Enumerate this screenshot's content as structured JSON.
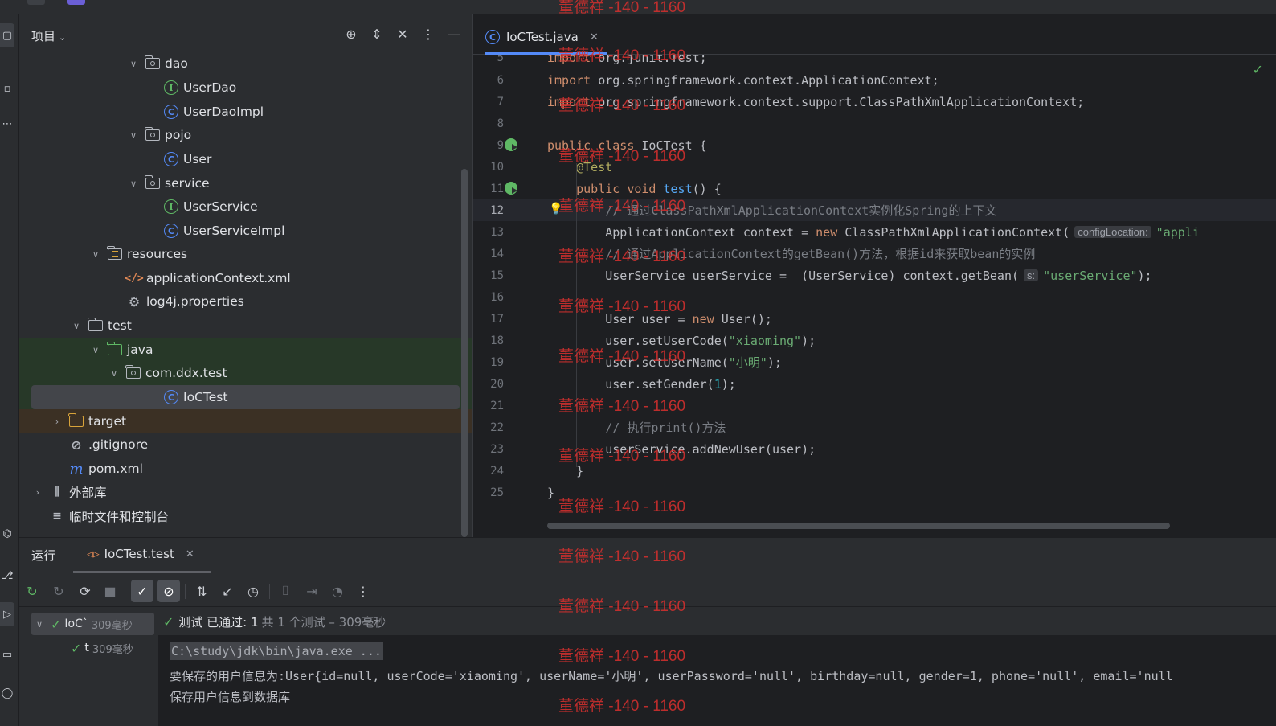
{
  "project": {
    "title": "项目",
    "tree": [
      {
        "label": "dao",
        "kind": "package",
        "expanded": true
      },
      {
        "label": "UserDao",
        "kind": "interface"
      },
      {
        "label": "UserDaoImpl",
        "kind": "class"
      },
      {
        "label": "pojo",
        "kind": "package",
        "expanded": true
      },
      {
        "label": "User",
        "kind": "class"
      },
      {
        "label": "service",
        "kind": "package",
        "expanded": true
      },
      {
        "label": "UserService",
        "kind": "interface"
      },
      {
        "label": "UserServiceImpl",
        "kind": "class"
      },
      {
        "label": "resources",
        "kind": "resources-folder",
        "expanded": true
      },
      {
        "label": "applicationContext.xml",
        "kind": "xml"
      },
      {
        "label": "log4j.properties",
        "kind": "properties"
      },
      {
        "label": "test",
        "kind": "folder",
        "expanded": true
      },
      {
        "label": "java",
        "kind": "test-source-folder",
        "expanded": true
      },
      {
        "label": "com.ddx.test",
        "kind": "package",
        "expanded": true
      },
      {
        "label": "IoCTest",
        "kind": "class",
        "selected": true
      },
      {
        "label": "target",
        "kind": "excluded-folder",
        "expanded": false
      },
      {
        "label": ".gitignore",
        "kind": "ignore-file"
      },
      {
        "label": "pom.xml",
        "kind": "maven"
      },
      {
        "label": "外部库",
        "kind": "library",
        "expanded": false
      },
      {
        "label": "临时文件和控制台",
        "kind": "scratch"
      }
    ]
  },
  "editor": {
    "tab_label": "IoCTest.java",
    "current_line": 12,
    "lines": [
      {
        "n": "5",
        "text": "import org.junit.Test;"
      },
      {
        "n": "6",
        "text": "import org.springframework.context.ApplicationContext;"
      },
      {
        "n": "7",
        "text": "import org.springframework.context.support.ClassPathXmlApplicationContext;"
      },
      {
        "n": "8",
        "text": ""
      },
      {
        "n": "9",
        "text": "public class IoCTest {"
      },
      {
        "n": "10",
        "text": "    @Test"
      },
      {
        "n": "11",
        "text": "    public void test() {"
      },
      {
        "n": "12",
        "text": "        // 通过ClassPathXmlApplicationContext实例化Spring的上下文"
      },
      {
        "n": "13",
        "text": "        ApplicationContext context = new ClassPathXmlApplicationContext(",
        "hint": "configLocation:",
        "tail": "\"appli"
      },
      {
        "n": "14",
        "text": "        // 通过ApplicationContext的getBean()方法，根据id来获取bean的实例"
      },
      {
        "n": "15",
        "text": "        UserService userService =  (UserService) context.getBean(",
        "hint": "s:",
        "tail": "\"userService\");"
      },
      {
        "n": "16",
        "text": ""
      },
      {
        "n": "17",
        "text": "        User user = new User();"
      },
      {
        "n": "18",
        "text": "        user.setUserCode(\"xiaoming\");"
      },
      {
        "n": "19",
        "text": "        user.setUserName(\"小明\");"
      },
      {
        "n": "20",
        "text": "        user.setGender(1);"
      },
      {
        "n": "21",
        "text": ""
      },
      {
        "n": "22",
        "text": "        // 执行print()方法"
      },
      {
        "n": "23",
        "text": "        userService.addNewUser(user);"
      },
      {
        "n": "24",
        "text": "    }"
      },
      {
        "n": "25",
        "text": "}"
      }
    ]
  },
  "run": {
    "panel_label": "运行",
    "tab_label": "IoCTest.test",
    "tests": [
      {
        "label": "IoC`",
        "duration": "309毫秒",
        "status": "passed"
      },
      {
        "label": "t",
        "duration": "309毫秒",
        "status": "passed"
      }
    ],
    "status_main": "测试 已通过: 1",
    "status_sub": "共 1 个测试 – 309毫秒",
    "console": [
      "C:\\study\\jdk\\bin\\java.exe ...",
      "要保存的用户信息为:User{id=null, userCode='xiaoming', userName='小明', userPassword='null', birthday=null, gender=1, phone='null', email='null",
      "保存用户信息到数据库"
    ]
  },
  "watermark": "董德祥 -140 - 1160",
  "colors": {
    "keyword": "#cf8e6d",
    "string": "#6aab73",
    "method": "#56a8f5",
    "annotation": "#b3ae60",
    "comment": "#7a7e85",
    "number": "#2aacb8",
    "pass": "#5fb865",
    "watermark": "#d9302e"
  }
}
